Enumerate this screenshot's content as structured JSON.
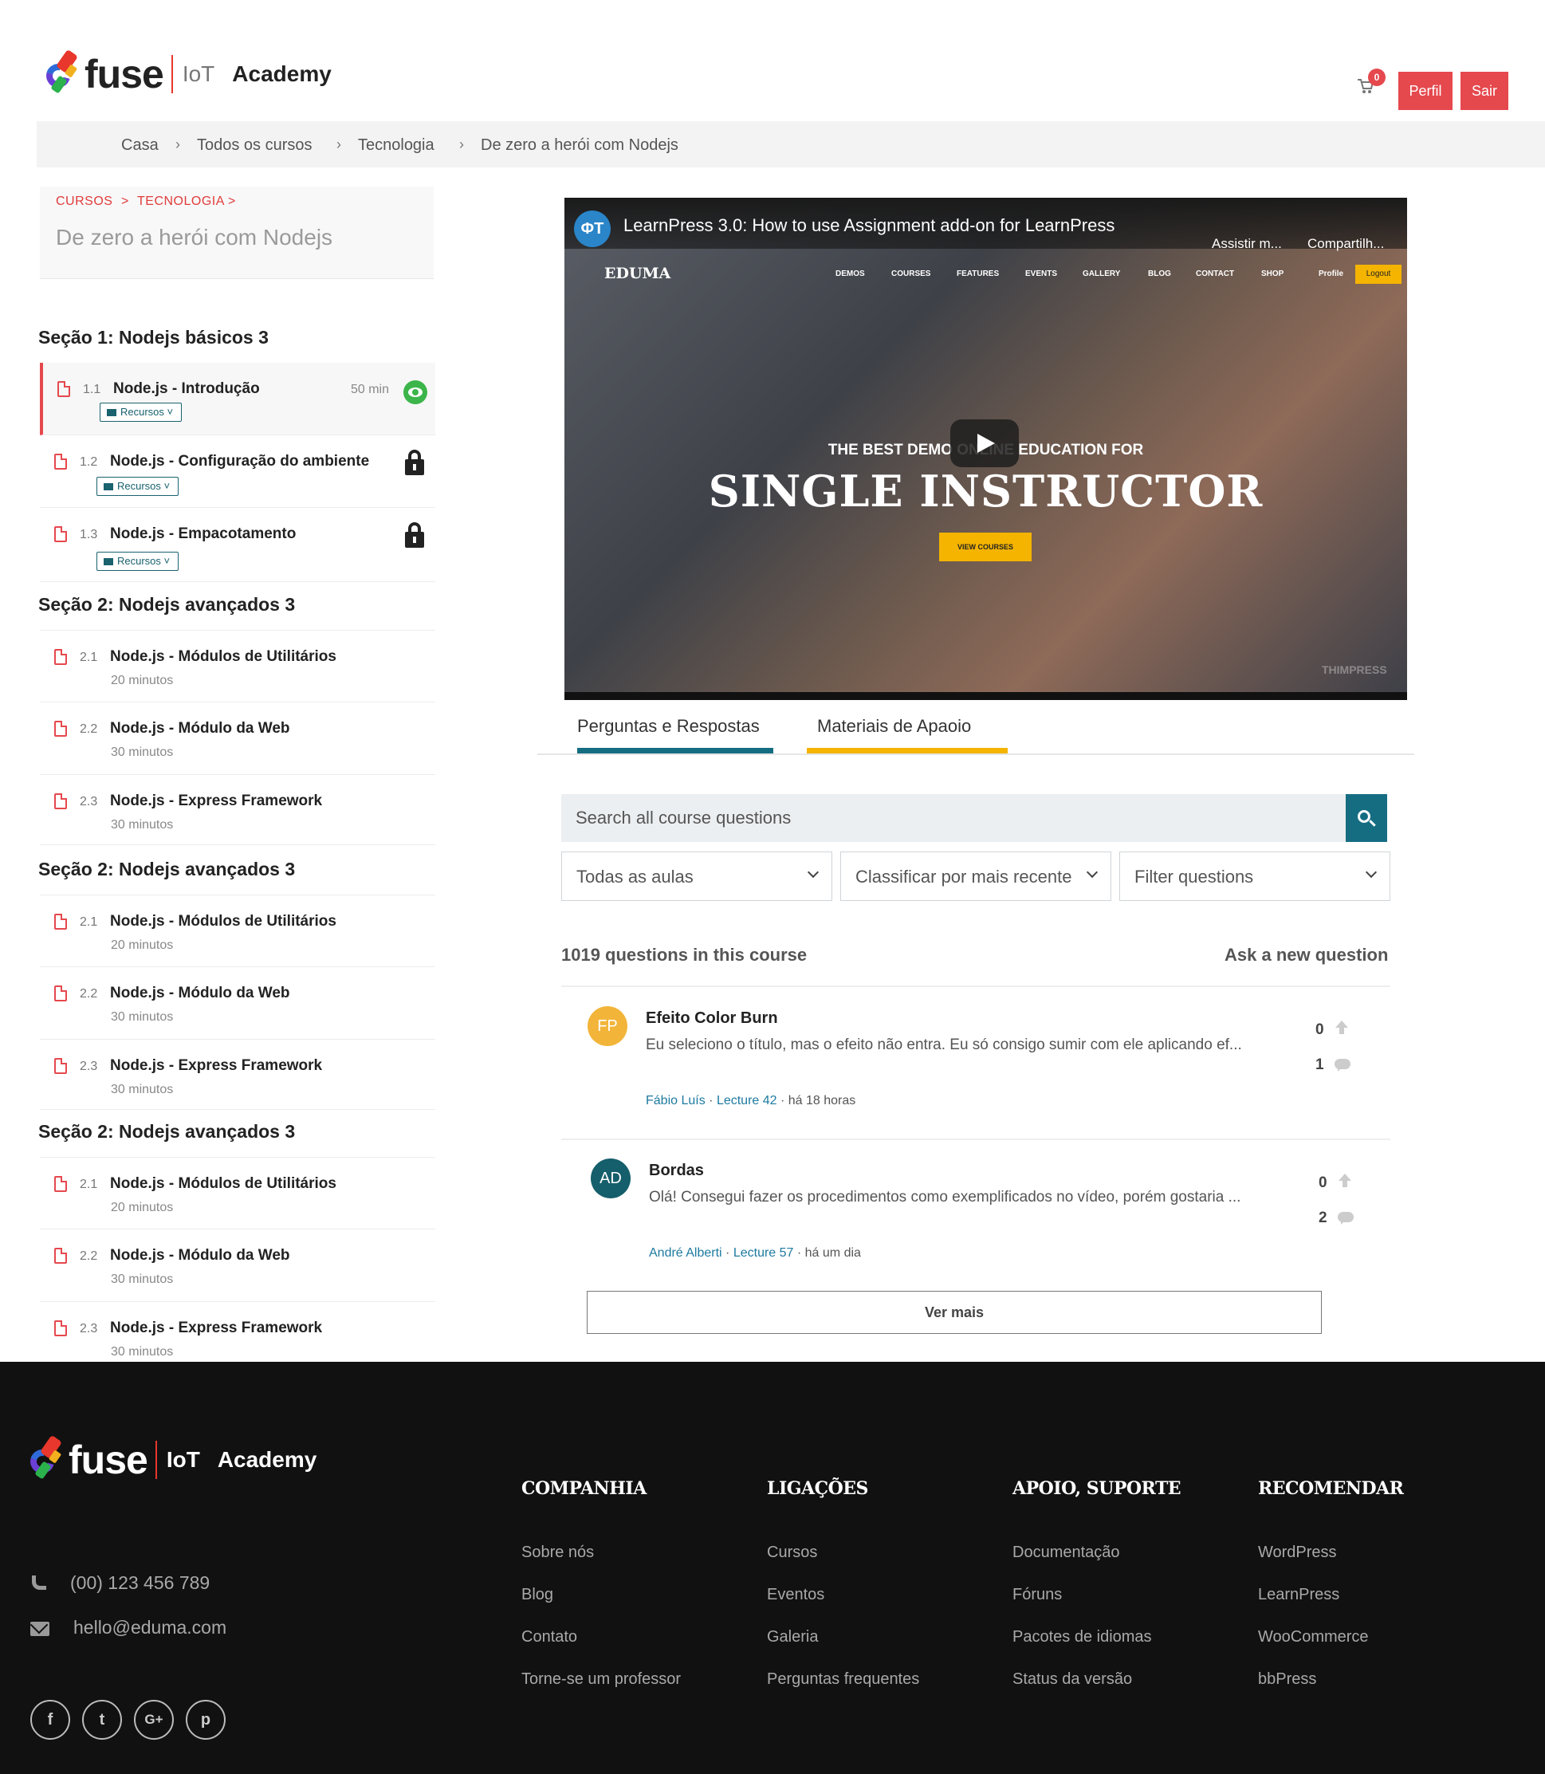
{
  "header": {
    "logo": {
      "word": "fuse",
      "iot": "IoT",
      "academy": "Academy"
    },
    "cart_count": "0",
    "profile_label": "Perfil",
    "logout_label": "Sair"
  },
  "breadcrumb": [
    "Casa",
    "Todos os cursos",
    "Tecnologia",
    "De zero a herói com Nodejs"
  ],
  "course_card": {
    "crumb_1": "CURSOS",
    "crumb_2": "TECNOLOGIA",
    "title": "De zero a herói com Nodejs"
  },
  "curriculum": {
    "resources_label": "Recursos",
    "sections": [
      {
        "title": "Seção 1: Nodejs básicos 3",
        "lessons": [
          {
            "num": "1.1",
            "name": "Node.js - Introdução",
            "duration": "50 min",
            "status": "preview"
          },
          {
            "num": "1.2",
            "name": "Node.js - Configuração do ambiente",
            "status": "locked"
          },
          {
            "num": "1.3",
            "name": "Node.js - Empacotamento",
            "status": "locked"
          }
        ]
      },
      {
        "title": "Seção 2: Nodejs avançados 3",
        "lessons": [
          {
            "num": "2.1",
            "name": "Node.js - Módulos de Utilitários",
            "duration": "20 minutos"
          },
          {
            "num": "2.2",
            "name": "Node.js - Módulo da Web",
            "duration": "30 minutos"
          },
          {
            "num": "2.3",
            "name": "Node.js - Express Framework",
            "duration": "30 minutos"
          }
        ]
      },
      {
        "title": "Seção 2: Nodejs avançados 3",
        "lessons": [
          {
            "num": "2.1",
            "name": "Node.js - Módulos de Utilitários",
            "duration": "20 minutos"
          },
          {
            "num": "2.2",
            "name": "Node.js - Módulo da Web",
            "duration": "30 minutos"
          },
          {
            "num": "2.3",
            "name": "Node.js - Express Framework",
            "duration": "30 minutos"
          }
        ]
      },
      {
        "title": "Seção 2: Nodejs avançados 3",
        "lessons": [
          {
            "num": "2.1",
            "name": "Node.js - Módulos de Utilitários",
            "duration": "20 minutos"
          },
          {
            "num": "2.2",
            "name": "Node.js - Módulo da Web",
            "duration": "30 minutos"
          },
          {
            "num": "2.3",
            "name": "Node.js - Express Framework",
            "duration": "30 minutos"
          }
        ]
      }
    ]
  },
  "video": {
    "channel_initials": "ΦT",
    "title": "LearnPress 3.0: How to use Assignment add-on for LearnPress",
    "watch_later": "Assistir m...",
    "share": "Compartilh...",
    "site_brand": "EDUMA",
    "site_nav": [
      "DEMOS",
      "COURSES",
      "FEATURES",
      "EVENTS",
      "GALLERY",
      "BLOG",
      "CONTACT",
      "SHOP",
      "Profile"
    ],
    "site_logout": "Logout",
    "hero_sub": "THE BEST DEMO ONLINE EDUCATION FOR",
    "hero_main": "SINGLE INSTRUCTOR",
    "hero_button": "VIEW COURSES",
    "watermark": "THIMPRESS"
  },
  "tabs": [
    {
      "label": "Perguntas e Respostas",
      "color": "#156d82"
    },
    {
      "label": "Materiais de Apaoio",
      "color": "#f4b400"
    }
  ],
  "qa": {
    "search_placeholder": "Search all course questions",
    "filters": [
      "Todas as aulas",
      "Classificar por mais recente",
      "Filter questions"
    ],
    "count_label": "1019 questions in this course",
    "ask_label": "Ask a new question",
    "questions": [
      {
        "initials": "FP",
        "avatar_color": "#f2b53a",
        "title": "Efeito Color Burn",
        "body": "Eu seleciono o título, mas o efeito não entra. Eu só consigo sumir com ele aplicando ef...",
        "author": "Fábio Luís",
        "lecture": "Lecture 42",
        "time": "há 18 horas",
        "votes": "0",
        "replies": "1"
      },
      {
        "initials": "AD",
        "avatar_color": "#155e6b",
        "title": "Bordas",
        "body": "Olá! Consegui fazer os procedimentos como exemplificados no vídeo, porém gostaria ...",
        "author": "André Alberti",
        "lecture": "Lecture 57",
        "time": "há um dia",
        "votes": "0",
        "replies": "2"
      }
    ],
    "more_label": "Ver mais"
  },
  "footer": {
    "phone": "(00) 123 456 789",
    "email": "hello@eduma.com",
    "columns": [
      {
        "title": "COMPANHIA",
        "links": [
          "Sobre nós",
          "Blog",
          "Contato",
          "Torne-se um professor"
        ]
      },
      {
        "title": "LIGAÇÕES",
        "links": [
          "Cursos",
          "Eventos",
          "Galeria",
          "Perguntas frequentes"
        ]
      },
      {
        "title": "APOIO, SUPORTE",
        "links": [
          "Documentação",
          "Fóruns",
          "Pacotes de idiomas",
          "Status da versão"
        ]
      },
      {
        "title": "RECOMENDAR",
        "links": [
          "WordPress",
          "LearnPress",
          "WooCommerce",
          "bbPress"
        ]
      }
    ],
    "social": [
      "facebook-icon",
      "twitter-icon",
      "google-plus-icon",
      "pinterest-icon"
    ]
  }
}
